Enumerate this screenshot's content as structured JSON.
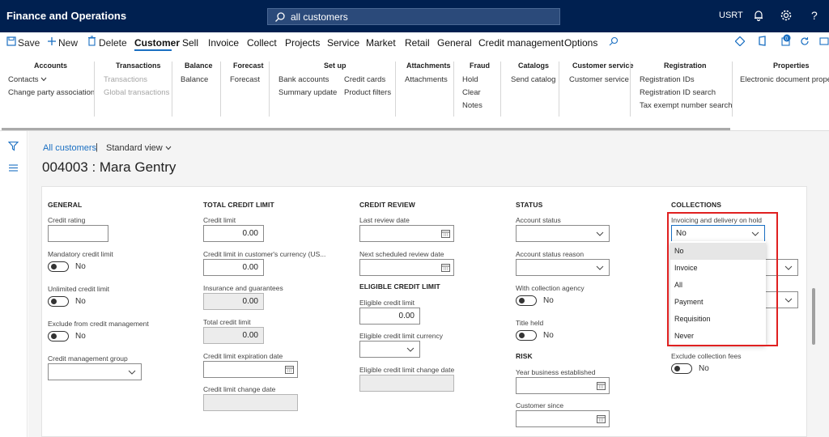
{
  "app": {
    "title": "Finance and Operations",
    "search_text": "all customers",
    "user_code": "USRT"
  },
  "actions": {
    "save": "Save",
    "new": "New",
    "delete": "Delete"
  },
  "tabs": [
    "Customer",
    "Sell",
    "Invoice",
    "Collect",
    "Projects",
    "Service",
    "Market",
    "Retail",
    "General",
    "Credit management",
    "Options"
  ],
  "ribbon": {
    "accounts": {
      "title": "Accounts",
      "items": [
        "Contacts",
        "Change party association"
      ]
    },
    "transactions": {
      "title": "Transactions",
      "items": [
        "Transactions",
        "Global transactions"
      ]
    },
    "balance": {
      "title": "Balance",
      "items": [
        "Balance"
      ]
    },
    "forecast": {
      "title": "Forecast",
      "items": [
        "Forecast"
      ]
    },
    "setup": {
      "title": "Set up",
      "items": [
        "Bank accounts",
        "Summary update",
        "Credit cards",
        "Product filters"
      ]
    },
    "attachments": {
      "title": "Attachments",
      "items": [
        "Attachments"
      ]
    },
    "fraud": {
      "title": "Fraud",
      "items": [
        "Hold",
        "Clear",
        "Notes"
      ]
    },
    "catalogs": {
      "title": "Catalogs",
      "items": [
        "Send catalog"
      ]
    },
    "customer_service": {
      "title": "Customer service",
      "items": [
        "Customer service"
      ]
    },
    "registration": {
      "title": "Registration",
      "items": [
        "Registration IDs",
        "Registration ID search",
        "Tax exempt number search"
      ]
    },
    "properties": {
      "title": "Properties",
      "items": [
        "Electronic document properti"
      ]
    }
  },
  "breadcrumb": {
    "all": "All customers",
    "sep": "|",
    "view": "Standard view"
  },
  "record_title": "004003 : Mara Gentry",
  "general": {
    "title": "GENERAL",
    "credit_rating": "Credit rating",
    "mandatory_credit_limit": "Mandatory credit limit",
    "unlimited_credit_limit": "Unlimited credit limit",
    "exclude_credit_mgmt": "Exclude from credit management",
    "credit_mgmt_group": "Credit management group",
    "no": "No"
  },
  "total_credit": {
    "title": "TOTAL CREDIT LIMIT",
    "credit_limit": "Credit limit",
    "credit_limit_value": "0.00",
    "credit_limit_currency": "Credit limit in customer's currency (US...",
    "credit_limit_currency_value": "0.00",
    "insurance": "Insurance and guarantees",
    "insurance_value": "0.00",
    "total_credit_limit": "Total credit limit",
    "total_credit_limit_value": "0.00",
    "expiration_date": "Credit limit expiration date",
    "change_date": "Credit limit change date"
  },
  "credit_review": {
    "title": "CREDIT REVIEW",
    "last_review": "Last review date",
    "next_review": "Next scheduled review date",
    "eligible_title": "ELIGIBLE CREDIT LIMIT",
    "eligible_limit": "Eligible credit limit",
    "eligible_limit_value": "0.00",
    "eligible_currency": "Eligible credit limit currency",
    "eligible_change_date": "Eligible credit limit change date"
  },
  "status": {
    "title": "STATUS",
    "account_status": "Account status",
    "account_status_reason": "Account status reason",
    "collection_agency": "With collection agency",
    "title_held": "Title held",
    "no": "No",
    "risk_title": "RISK",
    "year_established": "Year business established",
    "customer_since": "Customer since"
  },
  "collections": {
    "title": "COLLECTIONS",
    "hold_label": "Invoicing and delivery on hold",
    "hold_value": "No",
    "options": [
      "No",
      "Invoice",
      "All",
      "Payment",
      "Requisition",
      "Never"
    ],
    "exclude_fees": "Exclude collection fees",
    "no": "No"
  },
  "colors": {
    "topbar": "#002050",
    "accent": "#1a6fc2",
    "highlight": "#e02020"
  }
}
